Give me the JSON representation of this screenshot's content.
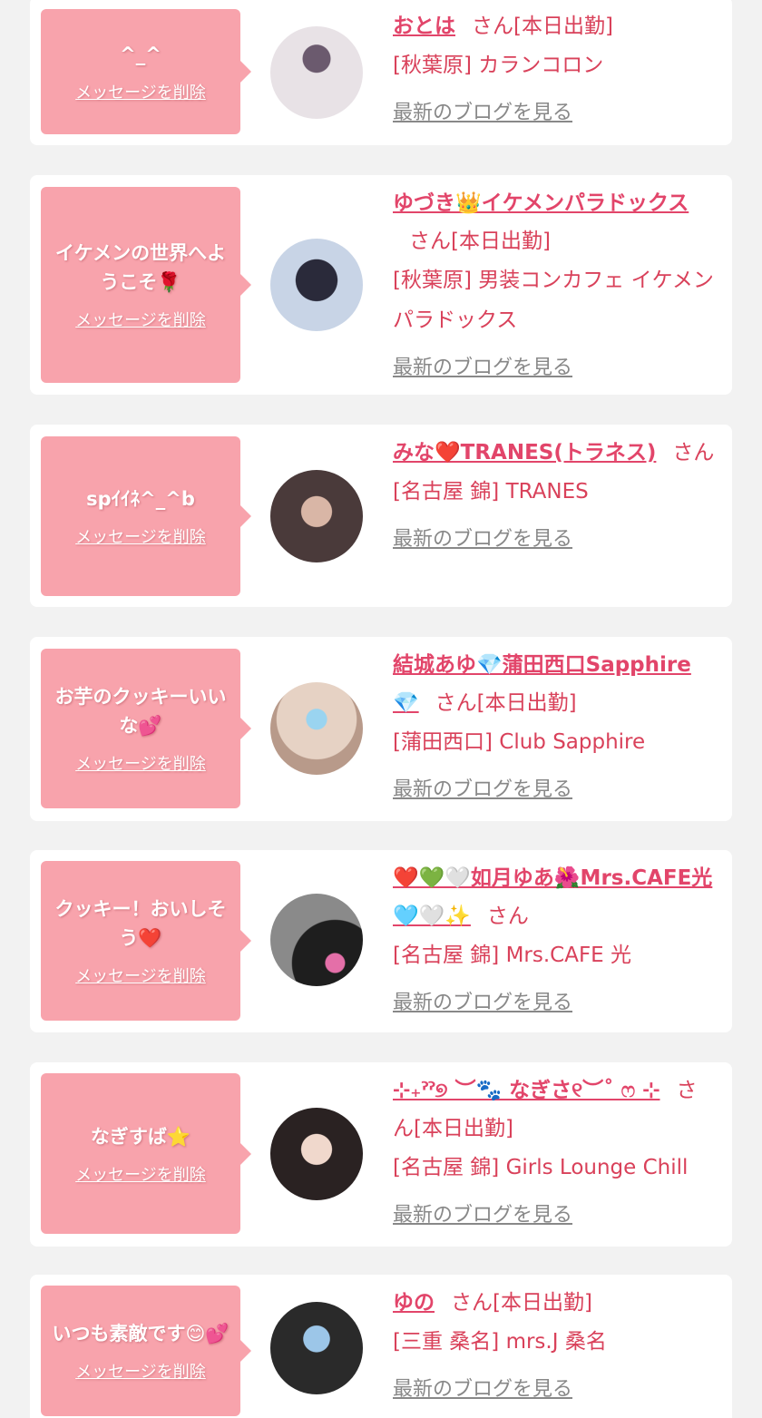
{
  "delete_label": "メッセージを削除",
  "blog_label": "最新のブログを見る",
  "colors": {
    "bubble": "#f8a3ac",
    "accent": "#e2456a",
    "link_gray": "#888888",
    "background": "#f2f2f2"
  },
  "items": [
    {
      "message": "^_^",
      "name": "おとは",
      "suffix": "さん[本日出勤]",
      "shop": "[秋葉原] カランコロン"
    },
    {
      "message": "イケメンの世界へようこそ🌹",
      "name": "ゆづき👑イケメンパラドックス",
      "suffix": "さん[本日出勤]",
      "shop": "[秋葉原] 男装コンカフェ イケメンパラドックス"
    },
    {
      "message": "spｲｲﾈ^_^b",
      "name": "みな❤️TRANES(トラネス)",
      "suffix": "さん",
      "shop": "[名古屋 錦] TRANES"
    },
    {
      "message": "お芋のクッキーいいな💕",
      "name": "結城あゆ💎蒲田西口Sapphire💎",
      "suffix": "さん[本日出勤]",
      "shop": "[蒲田西口] Club Sapphire"
    },
    {
      "message": "クッキー！おいしそう❤️",
      "name": "❤️💚🤍如月ゆあ🌺Mrs.CAFE光🩵🤍✨",
      "suffix": "さん",
      "shop": "[名古屋 錦] Mrs.CAFE 光"
    },
    {
      "message": "なぎすば⭐",
      "name": "⊹₊ˀˀ୭ ︶🐾 なぎさ୧︶˚ ෆ ⊹",
      "suffix": "さん[本日出勤]",
      "shop": "[名古屋 錦] Girls Lounge Chill"
    },
    {
      "message": "いつも素敵です😊💕",
      "name": "ゆの",
      "suffix": "さん[本日出勤]",
      "shop": "[三重 桑名] mrs.J 桑名"
    }
  ]
}
